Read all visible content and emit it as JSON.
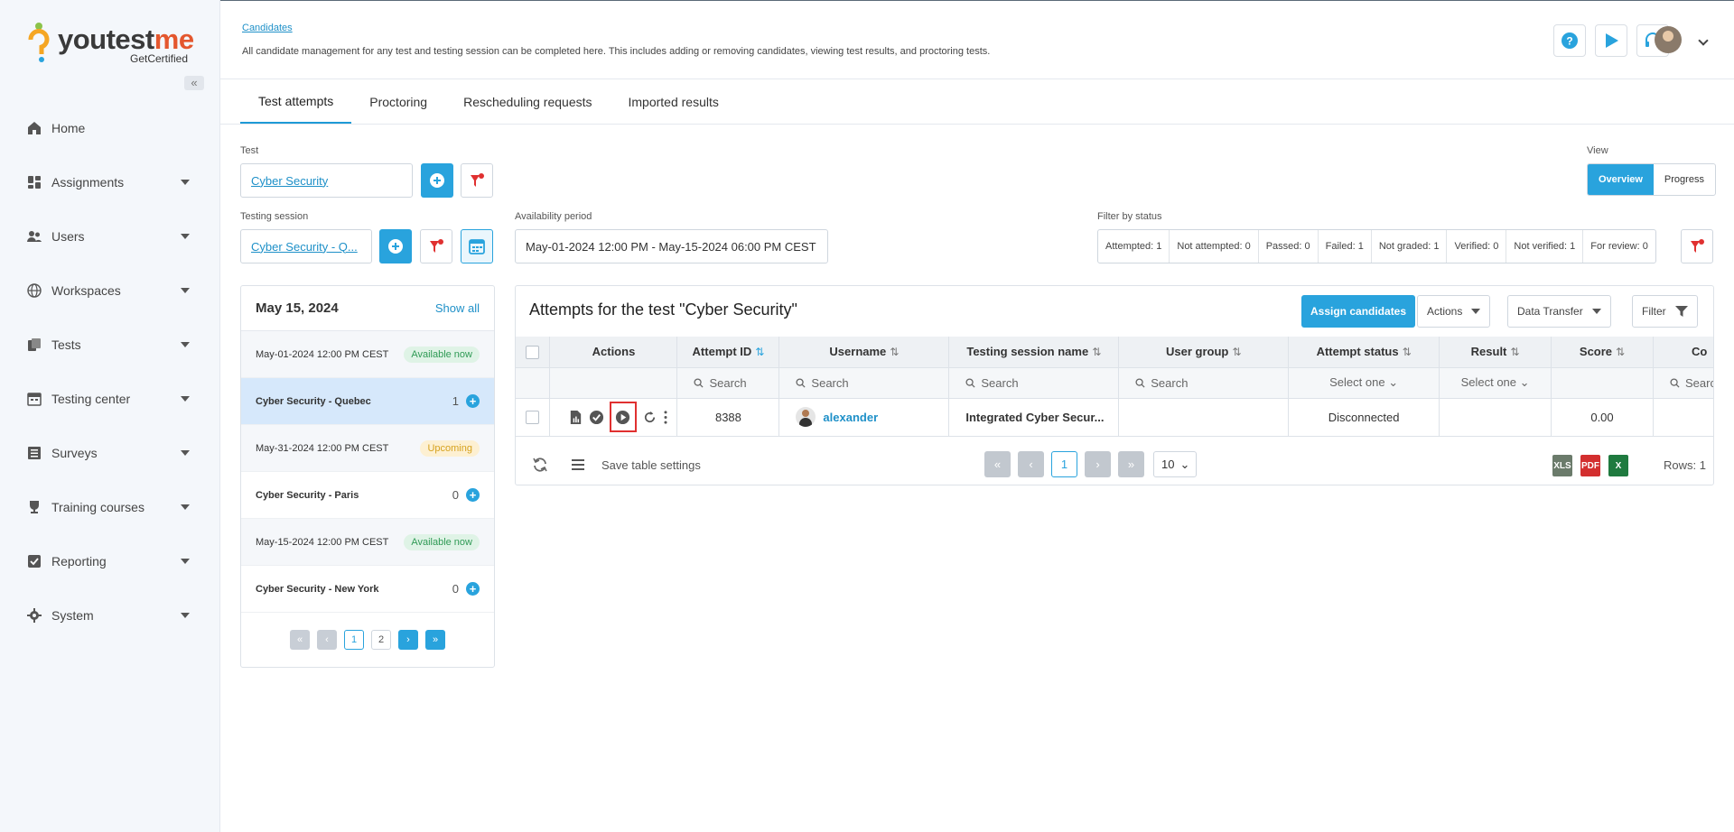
{
  "app": {
    "logo_main": "youtest",
    "logo_accent": "me",
    "logo_sub": "GetCertified",
    "collapse_icon": "«"
  },
  "sidebar": {
    "items": [
      {
        "label": "Home",
        "icon": "home-icon"
      },
      {
        "label": "Assignments",
        "icon": "dashboard-icon"
      },
      {
        "label": "Users",
        "icon": "users-icon"
      },
      {
        "label": "Workspaces",
        "icon": "globe-icon"
      },
      {
        "label": "Tests",
        "icon": "copy-icon"
      },
      {
        "label": "Testing center",
        "icon": "calendar-icon"
      },
      {
        "label": "Surveys",
        "icon": "list-icon"
      },
      {
        "label": "Training courses",
        "icon": "trophy-icon"
      },
      {
        "label": "Reporting",
        "icon": "report-icon"
      },
      {
        "label": "System",
        "icon": "gear-icon"
      }
    ]
  },
  "header": {
    "breadcrumb": "Candidates",
    "description": "All candidate management for any test and testing session can be completed here. This includes adding or removing candidates, viewing test results, and proctoring tests."
  },
  "tabs": [
    "Test attempts",
    "Proctoring",
    "Rescheduling requests",
    "Imported results"
  ],
  "filters": {
    "test_label": "Test",
    "test_value": "Cyber Security",
    "session_label": "Testing session",
    "session_value": "Cyber Security - Q...",
    "availability_label": "Availability period",
    "availability_value": "May-01-2024 12:00 PM - May-15-2024 06:00 PM CEST",
    "status_label": "Filter by status",
    "statuses": [
      "Attempted: 1",
      "Not attempted: 0",
      "Passed: 0",
      "Failed: 1",
      "Not graded: 1",
      "Verified: 0",
      "Not verified: 1",
      "For review: 0"
    ],
    "view_label": "View",
    "view_options": [
      "Overview",
      "Progress"
    ]
  },
  "calendar": {
    "date": "May 15, 2024",
    "show_all": "Show all",
    "rows": [
      {
        "type": "date",
        "text": "May-01-2024 12:00 PM CEST",
        "badge": "Available now"
      },
      {
        "type": "session",
        "text": "Cyber Security - Quebec",
        "count": "1"
      },
      {
        "type": "date",
        "text": "May-31-2024 12:00 PM CEST",
        "badge": "Upcoming"
      },
      {
        "type": "session",
        "text": "Cyber Security - Paris",
        "count": "0"
      },
      {
        "type": "date",
        "text": "May-15-2024 12:00 PM CEST",
        "badge": "Available now"
      },
      {
        "type": "session",
        "text": "Cyber Security - New York",
        "count": "0"
      }
    ],
    "pager": {
      "first": "«",
      "prev": "‹",
      "pages": [
        "1",
        "2"
      ],
      "next": "›",
      "last": "»"
    }
  },
  "attempts": {
    "title": "Attempts for the test \"Cyber Security\"",
    "assign_button": "Assign candidates",
    "actions_button": "Actions",
    "data_transfer_button": "Data Transfer",
    "filter_button": "Filter",
    "columns": [
      "Actions",
      "Attempt ID",
      "Username",
      "Testing session name",
      "User group",
      "Attempt status",
      "Result",
      "Score",
      "Co"
    ],
    "search_placeholder": "Search",
    "select_placeholder": "Select one",
    "row": {
      "attempt_id": "8388",
      "username": "alexander",
      "session": "Integrated Cyber Secur...",
      "user_group": "",
      "status": "Disconnected",
      "result": "",
      "score": "0.00"
    },
    "footer": {
      "save_settings": "Save table settings",
      "page": "1",
      "page_size": "10",
      "rows": "Rows: 1",
      "first": "«",
      "prev": "‹",
      "next": "›",
      "last": "»",
      "export_labels": [
        "XLS",
        "PDF",
        "X"
      ]
    }
  },
  "colors": {
    "accent": "#29a3dd",
    "brand_orange": "#e4572e",
    "highlight": "#e03030",
    "available": "#2f9a55",
    "upcoming": "#d6a21e"
  }
}
